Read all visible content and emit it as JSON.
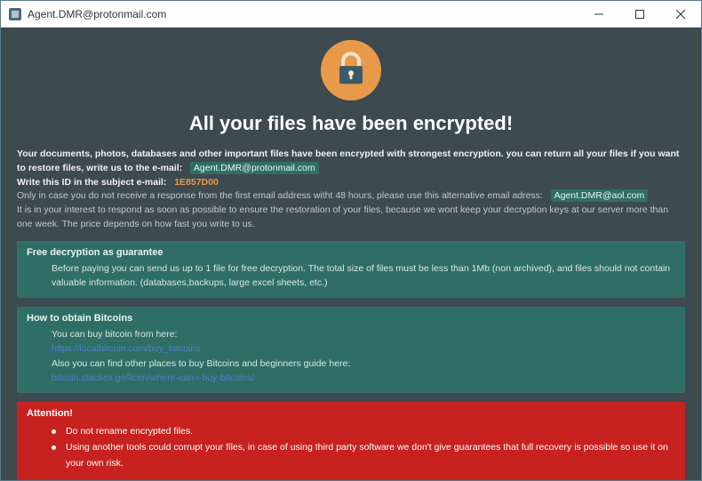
{
  "window": {
    "title": "Agent.DMR@protonmail.com"
  },
  "headline": "All your files have been encrypted!",
  "intro": {
    "line1_a": "Your documents, photos, databases and other important files have been encrypted with strongest encryption. you can return all your files if you want to restore files, write us to the e-mail:",
    "email1": "Agent.DMR@protonmail.com",
    "line2_a": "Write this ID in the subject e-mail:",
    "id": "1E857D00",
    "line3_a": "Only in case you do not receive a response from the first email address witht 48 hours, please use this alternative email adress:",
    "email2": "Agent.DMR@aol.com",
    "line4": "It is in your interest to respond as soon as possible to ensure the restoration of your files, because we wont keep your decryption keys at our server more than one week. The price depends on how fast you write to us."
  },
  "decrypt_panel": {
    "title": "Free decryption as guarantee",
    "body": "Before paying you can send us up to 1 file for free decryption. The total size of files must be less than 1Mb (non archived), and files should not contain valuable information. (databases,backups, large excel sheets, etc.)"
  },
  "bitcoin_panel": {
    "title": "How to obtain Bitcoins",
    "line1": "You can buy bitcoin from here:",
    "link1": "https://localbitcoin.com/buy_bitcoins",
    "line2": "Also you can find other places to buy Bitcoins and beginners guide here:",
    "link2": "bitcoin.stackex.ge/licen/where-can-i-buy-bitcoins/"
  },
  "alert": {
    "title": "Attention!",
    "item1": "Do not rename encrypted files.",
    "item2": "Using another tools could corrupt your files, in case of using third party software we don't give guarantees that full recovery is possible so use it on your own risk."
  }
}
